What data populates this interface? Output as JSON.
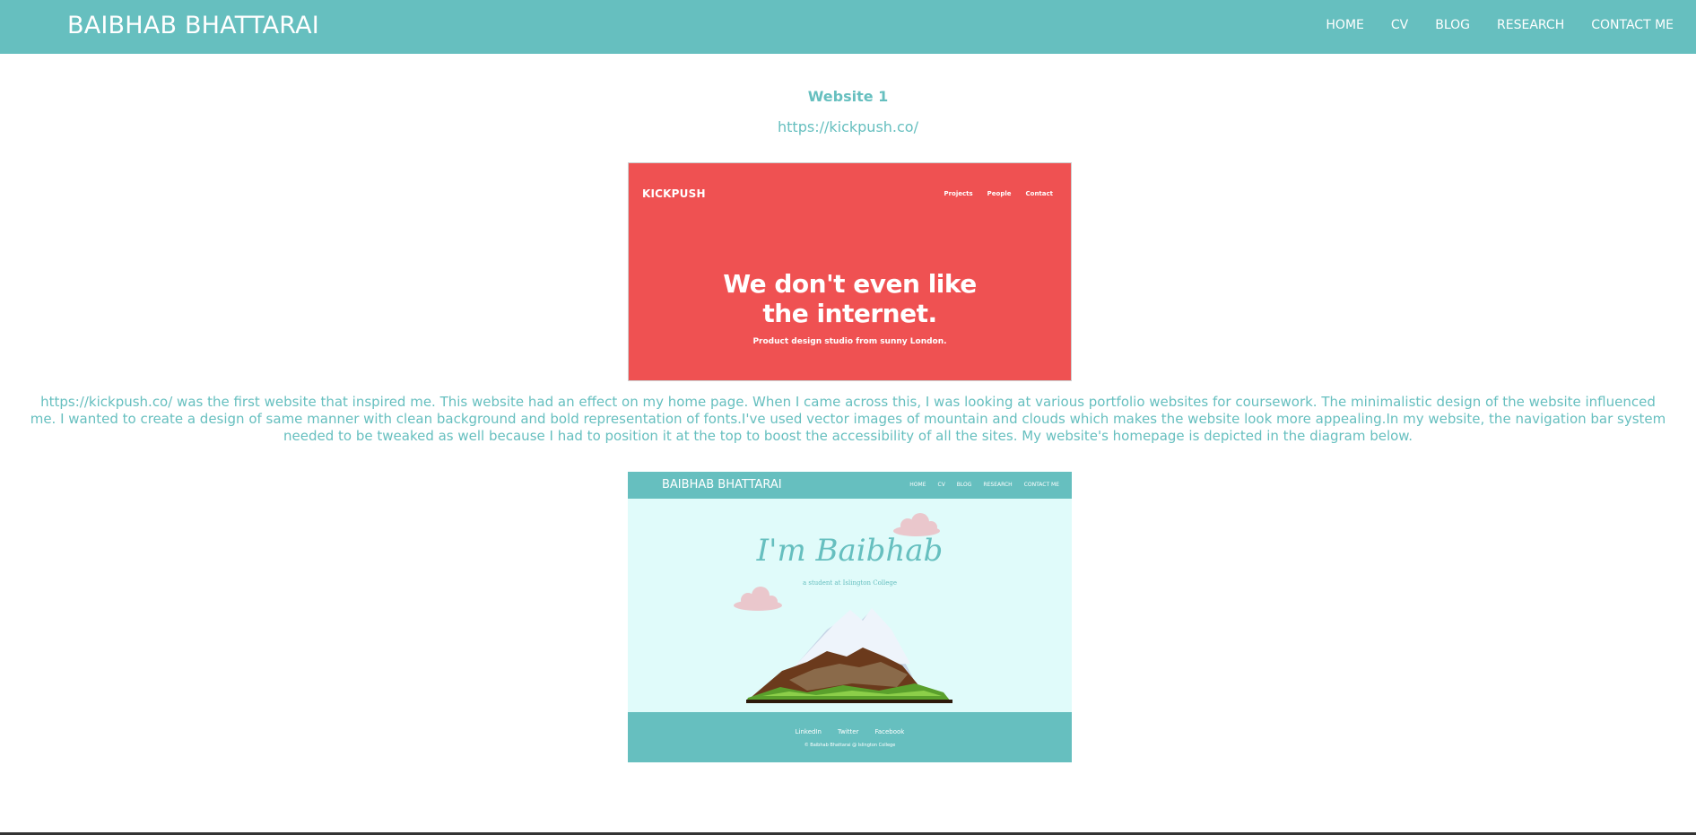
{
  "navbar": {
    "brand": "BAIBHAB BHATTARAI",
    "links": [
      "HOME",
      "CV",
      "BLOG",
      "RESEARCH",
      "CONTACT ME"
    ]
  },
  "main": {
    "subtitle": "Website 1",
    "link": "https://kickpush.co/",
    "paragraph": "https://kickpush.co/ was the first website that inspired me. This website had an effect on my home page. When I came across this, I was looking at various portfolio websites for coursework. The minimalistic design of the website influenced me. I wanted to create a design of same manner with clean background and bold representation of fonts.I've used vector images of mountain and clouds which makes the website look more appealing.In my website, the navigation bar system needed to be tweaked as well because I had to position it at the top to boost the accessibility of all the sites. My website's homepage is depicted in the diagram below."
  },
  "kickpush_screenshot": {
    "logo": "KICKPUSH",
    "nav": [
      "Projects",
      "People",
      "Contact"
    ],
    "headline_line1": "We don't even like",
    "headline_line2": "the internet.",
    "subline": "Product design studio from sunny London."
  },
  "homepage_screenshot": {
    "brand": "BAIBHAB BHATTARAI",
    "nav": [
      "HOME",
      "CV",
      "BLOG",
      "RESEARCH",
      "CONTACT ME"
    ],
    "title": "I'm Baibhab",
    "caption": "a student at Islington College",
    "footer_links": [
      "LinkedIn",
      "Twitter",
      "Facebook"
    ],
    "copyright": "© Baibhab Bhattarai @ Islington College"
  },
  "colors": {
    "accent": "#66bfbf",
    "kickpush_red": "#ef5152",
    "hero_bg": "#e0fbfa",
    "cloud": "#eac7cc"
  }
}
